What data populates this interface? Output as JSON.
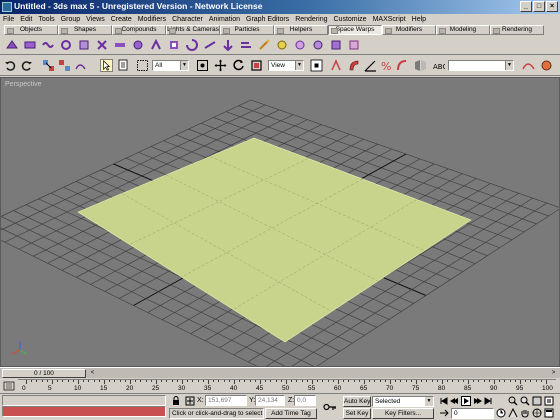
{
  "window": {
    "title": "Untitled - 3ds max 5 - Unregistered Version - Network License",
    "minimize": "_",
    "maximize": "□",
    "close": "×"
  },
  "menu": [
    "File",
    "Edit",
    "Tools",
    "Group",
    "Views",
    "Create",
    "Modifiers",
    "Character",
    "Animation",
    "Graph Editors",
    "Rendering",
    "Customize",
    "MAXScript",
    "Help"
  ],
  "tabs": [
    {
      "label": "Objects"
    },
    {
      "label": "Shapes"
    },
    {
      "label": "Compounds"
    },
    {
      "label": "Lights & Cameras"
    },
    {
      "label": "Particles"
    },
    {
      "label": "Helpers"
    },
    {
      "label": "Space Warps",
      "active": true
    },
    {
      "label": "Modifiers"
    },
    {
      "label": "Modeling"
    },
    {
      "label": "Rendering"
    }
  ],
  "toolbar": {
    "selection_filter": "All",
    "ref_coord": "View",
    "named_selection": ""
  },
  "viewport": {
    "label": "Perspective",
    "plane_color": "#c8d48c",
    "background": "#7a7a7a"
  },
  "timeslider": {
    "frame_display": "0 / 100",
    "prev": "<",
    "next": ">"
  },
  "trackbar": {
    "ticks": [
      "0",
      "5",
      "10",
      "15",
      "20",
      "25",
      "30",
      "35",
      "40",
      "45",
      "50",
      "55",
      "60",
      "65",
      "70",
      "75",
      "80",
      "85",
      "90",
      "95",
      "100"
    ]
  },
  "status": {
    "message": "",
    "prompt": "Click or click-and-drag to select obj",
    "add_time_tag": "Add Time Tag",
    "x_label": "X:",
    "x_value": "151,697",
    "y_label": "Y:",
    "y_value": "24,134",
    "z_label": "Z:",
    "z_value": "0,0",
    "auto_key": "Auto Key",
    "set_key": "Set Key",
    "key_mode_select": "Selected",
    "key_filters": "Key Filters...",
    "current_frame": "0"
  }
}
